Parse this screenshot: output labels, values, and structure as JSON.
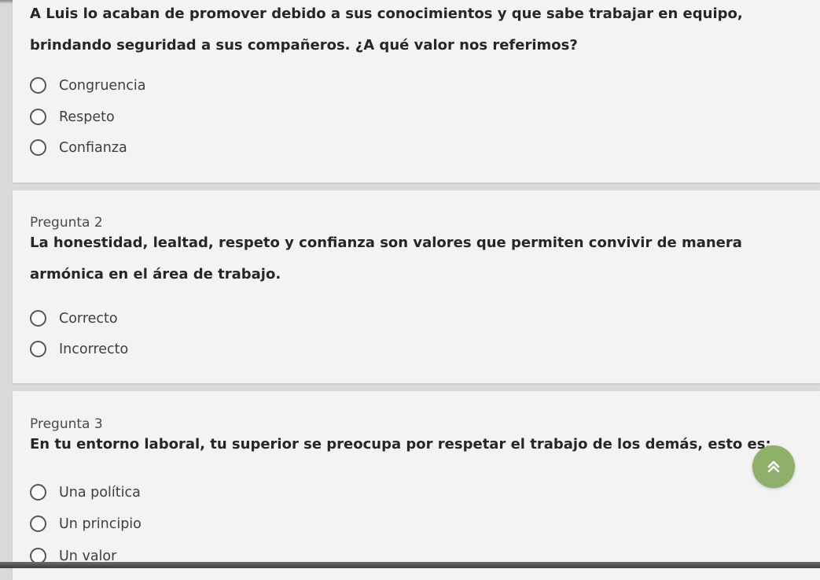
{
  "questions": [
    {
      "number_label": "",
      "text": "A Luis lo acaban de promover debido a sus conocimientos y que sabe trabajar en equipo, brindando seguridad a sus compañeros. ¿A qué valor nos referimos?",
      "options": [
        "Congruencia",
        "Respeto",
        "Confianza"
      ]
    },
    {
      "number_label": "Pregunta 2",
      "text": "La honestidad, lealtad, respeto y confianza son valores que permiten convivir de manera armónica en el área de trabajo.",
      "options": [
        "Correcto",
        "Incorrecto"
      ]
    },
    {
      "number_label": "Pregunta 3",
      "text": "En tu entorno laboral, tu superior se preocupa por respetar el trabajo de los demás, esto es:",
      "options": [
        "Una política",
        "Un principio",
        "Un valor"
      ]
    }
  ],
  "scroll_top_icon": "double-chevron-up-icon",
  "colors": {
    "page_background": "#d9dadb",
    "card_background": "#f3f3f3",
    "scroll_button": "#8eb06a"
  }
}
